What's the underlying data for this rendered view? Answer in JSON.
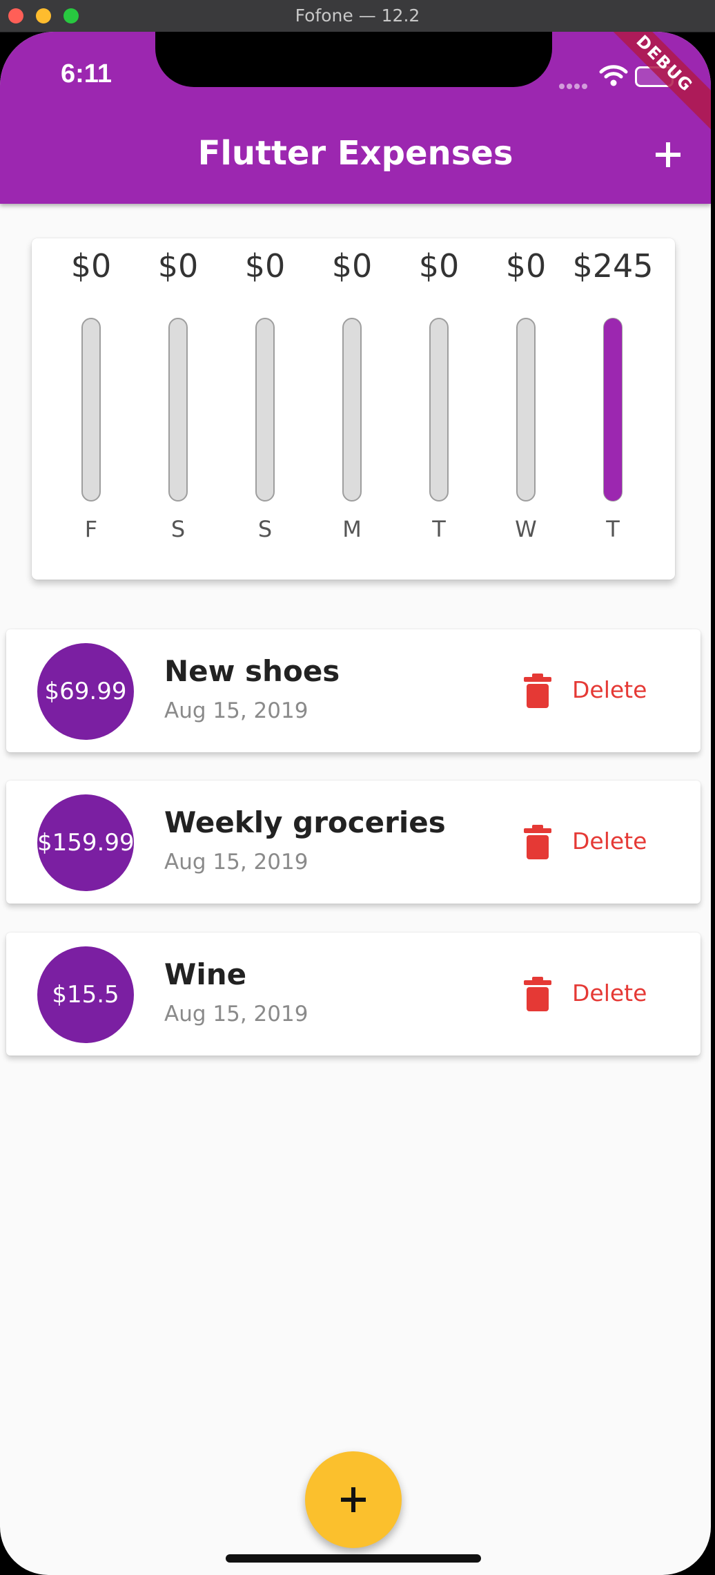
{
  "window": {
    "title": "Fofone — 12.2"
  },
  "status_bar": {
    "time": "6:11",
    "debug_banner": "DEBUG"
  },
  "app_bar": {
    "title": "Flutter Expenses",
    "add_icon": "plus-icon"
  },
  "chart_data": {
    "type": "bar",
    "categories": [
      "F",
      "S",
      "S",
      "M",
      "T",
      "W",
      "T"
    ],
    "values": [
      0,
      0,
      0,
      0,
      0,
      0,
      245
    ],
    "labels": [
      "$0",
      "$0",
      "$0",
      "$0",
      "$0",
      "$0",
      "$245"
    ],
    "title": "",
    "xlabel": "",
    "ylabel": "",
    "ylim": [
      0,
      245
    ],
    "colors": {
      "fill": "#9c27b0",
      "track": "#dcdcdc",
      "track_border": "#9e9e9e"
    }
  },
  "transactions": [
    {
      "amount": "$69.99",
      "title": "New shoes",
      "date": "Aug 15, 2019",
      "delete_label": "Delete"
    },
    {
      "amount": "$159.99",
      "title": "Weekly groceries",
      "date": "Aug 15, 2019",
      "delete_label": "Delete"
    },
    {
      "amount": "$15.5",
      "title": "Wine",
      "date": "Aug 15, 2019",
      "delete_label": "Delete"
    }
  ],
  "fab": {
    "icon": "plus-icon"
  },
  "colors": {
    "primary": "#9c27b0",
    "avatar": "#7b1fa2",
    "accent": "#fbc02d",
    "danger": "#e53935"
  }
}
